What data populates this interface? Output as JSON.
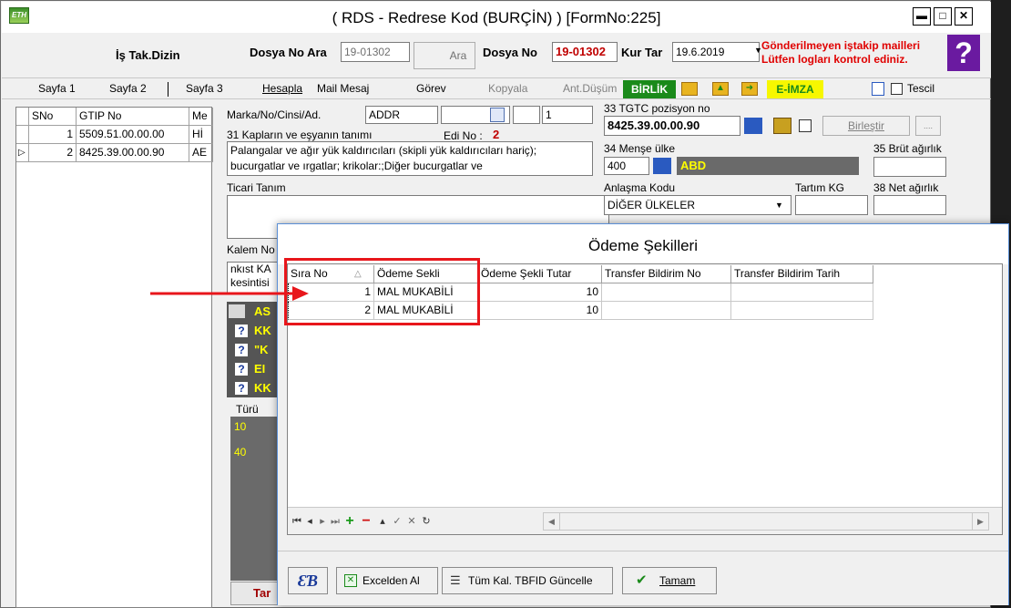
{
  "window": {
    "title": "( RDS - Redrese Kod (BURÇİN) ) [FormNo:225]",
    "logo_text": "ETH",
    "btn_min": "▬",
    "btn_max": "□",
    "btn_close": "✕"
  },
  "header": {
    "is_tak_dizin": "İş Tak.Dizin",
    "dosya_no_ara_label": "Dosya No Ara",
    "dosya_no_ara_value": "19-01302",
    "ara_button": "Ara",
    "dosya_no_label": "Dosya No",
    "dosya_no_value": "19-01302",
    "kur_tar_label": "Kur Tar",
    "kur_tar_value": "19.6.2019",
    "warning_line1": "Gönderilmeyen iştakip mailleri",
    "warning_line2": "Lütfen logları kontrol ediniz.",
    "help_icon": "?"
  },
  "tabs": [
    {
      "label": "Sayfa 1"
    },
    {
      "label": "Sayfa 2"
    },
    {
      "label": "Sayfa 3"
    },
    {
      "label": "Hesapla"
    },
    {
      "label": "Mail Mesaj"
    },
    {
      "label": "Görev"
    },
    {
      "label": "Kopyala"
    },
    {
      "label": "Ant.Düşüm"
    },
    {
      "label": "BİRLİK"
    },
    {
      "label": "E-İMZA"
    },
    {
      "label": "Tescil"
    }
  ],
  "left_grid": {
    "headers": [
      "SNo",
      "GTIP No",
      "Me"
    ],
    "rows": [
      {
        "sno": "1",
        "gtip": "5509.51.00.00.00",
        "me": "Hİ"
      },
      {
        "sno": "2",
        "gtip": "8425.39.00.00.90",
        "me": "AE"
      }
    ]
  },
  "form": {
    "marka_label": "Marka/No/Cinsi/Ad.",
    "marka_value": "ADDR",
    "marka_num": "1",
    "kaplar_label": "31 Kapların ve eşyanın tanımı",
    "edi_no_label": "Edi No :",
    "edi_no_value": "2",
    "tanim_line1": "Palangalar ve ağır yük kaldırıcıları (skipli yük kaldırıcıları hariç);",
    "tanim_line2": "bucurgatlar ve ırgatlar; krikolar:;Diğer bucurgatlar ve",
    "ticari_tanim_label": "Ticari Tanım",
    "kalem_no_label": "Kalem No",
    "nkist_text": "nkıst KA",
    "kesintisi_text": "kesintisi",
    "tgtc_label": "33 TGTC pozisyon no",
    "tgtc_value": "8425.39.00.00.90",
    "birlestir_button": "Birleştir",
    "dots_button": "....",
    "mense_label": "34 Menşe ülke",
    "mense_code": "400",
    "mense_name": "ABD",
    "brut_label": "35 Brüt ağırlık",
    "anlasma_label": "Anlaşma Kodu",
    "anlasma_value": "DİĞER ÜLKELER",
    "tartim_label": "Tartım KG",
    "net_label": "38 Net ağırlık",
    "turu_label": "Türü",
    "turu_rows": [
      "10",
      "40"
    ],
    "side_labels": [
      "AS",
      "KK",
      "\"K",
      "EI",
      "KK"
    ],
    "tar_button": "Tar"
  },
  "dialog": {
    "title": "Ödeme Şekilleri",
    "columns": [
      "Sıra No",
      "Ödeme Sekli",
      "Ödeme Şekli Tutar",
      "Transfer Bildirim No",
      "Transfer Bildirim Tarih"
    ],
    "rows": [
      {
        "sira": "1",
        "odeme": "MAL MUKABİLİ",
        "tutar": "10",
        "tbn": "",
        "tbt": ""
      },
      {
        "sira": "2",
        "odeme": "MAL MUKABİLİ",
        "tutar": "10",
        "tbn": "",
        "tbt": ""
      }
    ],
    "excel_button": "Excelden Al",
    "tum_kal_button": "Tüm Kal. TBFID Güncelle",
    "tamam_button": "Tamam"
  },
  "colors": {
    "highlight_red": "#e8161b",
    "birlik_green": "#1a8a1a",
    "eimza_yellow": "#f7f700",
    "warning_red": "#e00000",
    "help_purple": "#6a1aa0"
  }
}
